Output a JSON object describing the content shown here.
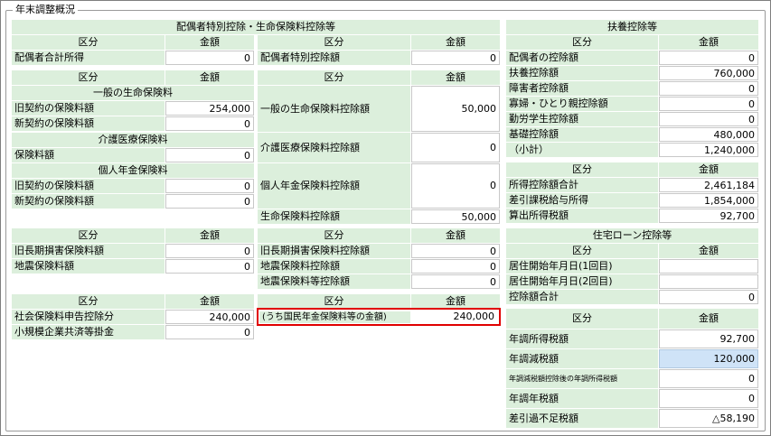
{
  "title": "年末調整概況",
  "col_kubun": "区分",
  "col_kingaku": "金額",
  "spouse_section": {
    "header": "配偶者特別控除・生命保険料控除等",
    "left": {
      "label": "配偶者合計所得",
      "value": "0"
    },
    "right": {
      "label": "配偶者特別控除額",
      "value": "0"
    }
  },
  "life": {
    "general_header": "一般の生命保険料",
    "general_old": {
      "label": "旧契約の保険料額",
      "value": "254,000"
    },
    "general_new": {
      "label": "新契約の保険料額",
      "value": "0"
    },
    "general_deduction": {
      "label": "一般の生命保険料控除額",
      "value": "50,000"
    },
    "care_header": "介護医療保険料",
    "care_premium": {
      "label": "保険料額",
      "value": "0"
    },
    "care_deduction": {
      "label": "介護医療保険料控除額",
      "value": "0"
    },
    "pension_header": "個人年金保険料",
    "pension_old": {
      "label": "旧契約の保険料額",
      "value": "0"
    },
    "pension_new": {
      "label": "新契約の保険料額",
      "value": "0"
    },
    "pension_deduction": {
      "label": "個人年金保険料控除額",
      "value": "0"
    },
    "total": {
      "label": "生命保険料控除額",
      "value": "50,000"
    }
  },
  "earthquake": {
    "left": [
      {
        "label": "旧長期損害保険料額",
        "value": "0"
      },
      {
        "label": "地震保険料額",
        "value": "0"
      }
    ],
    "right": [
      {
        "label": "旧長期損害保険料控除額",
        "value": "0"
      },
      {
        "label": "地震保険料控除額",
        "value": "0"
      },
      {
        "label": "地震保険料等控除額",
        "value": "0"
      }
    ]
  },
  "social": {
    "left": [
      {
        "label": "社会保険料申告控除分",
        "value": "240,000"
      },
      {
        "label": "小規模企業共済等掛金",
        "value": "0"
      }
    ],
    "right": {
      "label": "(うち国民年金保険料等の金額)",
      "value": "240,000"
    }
  },
  "dependent": {
    "header": "扶養控除等",
    "rows": [
      {
        "label": "配偶者の控除額",
        "value": "0"
      },
      {
        "label": "扶養控除額",
        "value": "760,000"
      },
      {
        "label": "障害者控除額",
        "value": "0"
      },
      {
        "label": "寡婦・ひとり親控除額",
        "value": "0"
      },
      {
        "label": "勤労学生控除額",
        "value": "0"
      },
      {
        "label": "基礎控除額",
        "value": "480,000"
      },
      {
        "label": "（小計）",
        "value": "1,240,000"
      }
    ]
  },
  "income": {
    "rows": [
      {
        "label": "所得控除額合計",
        "value": "2,461,184"
      },
      {
        "label": "差引課税給与所得",
        "value": "1,854,000"
      },
      {
        "label": "算出所得税額",
        "value": "92,700"
      }
    ]
  },
  "housing": {
    "header": "住宅ローン控除等",
    "rows": [
      {
        "label": "居住開始年月日(1回目)",
        "value": ""
      },
      {
        "label": "居住開始年月日(2回目)",
        "value": ""
      },
      {
        "label": "控除額合計",
        "value": "0"
      }
    ]
  },
  "tax": {
    "rows": [
      {
        "label": "年調所得税額",
        "value": "92,700"
      },
      {
        "label": "年調減税額",
        "value": "120,000"
      },
      {
        "label": "年調減税額控除後の年調所得税額",
        "value": "0"
      },
      {
        "label": "年調年税額",
        "value": "0"
      },
      {
        "label": "差引過不足税額",
        "value": "△58,190"
      }
    ]
  },
  "colors": {
    "header_bg": "#dcefdc",
    "highlight_bg": "#cfe3f7",
    "frame_red": "#e00000"
  }
}
